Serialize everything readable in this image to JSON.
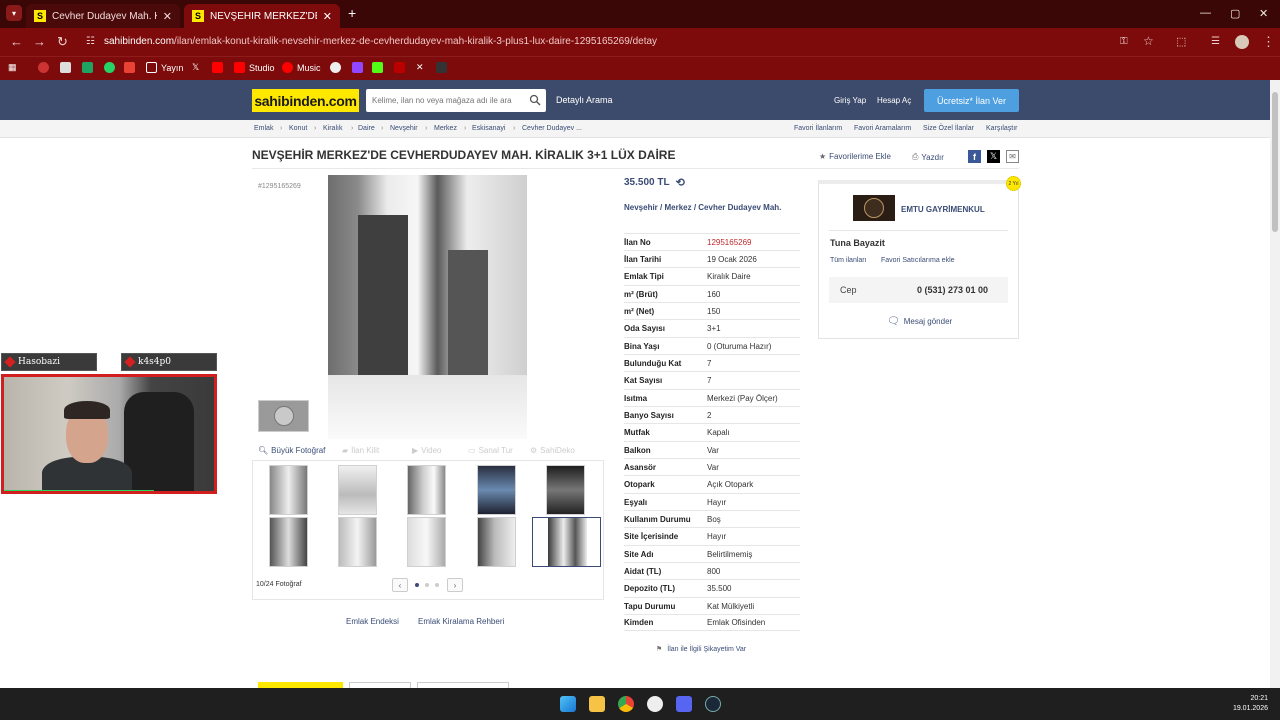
{
  "browser": {
    "tabs": [
      {
        "title": "Cevher Dudayev Mah. Kiralık Da",
        "active": false
      },
      {
        "title": "NEVŞEHİR MERKEZ'DE CEVHE",
        "active": true
      }
    ],
    "new_tab": "+",
    "url_host": "sahibinden.com",
    "url_path": "/ilan/emlak-konut-kiralik-nevsehir-merkez-de-cevherdudayev-mah-kiralik-3-plus1-lux-daire-1295165269/detay",
    "bookmarks": [
      "Yayın",
      "Studio",
      "Music"
    ]
  },
  "header": {
    "logo": "sahibinden.com",
    "search_placeholder": "Kelime, ilan no veya mağaza adı ile ara",
    "advanced_search": "Detaylı Arama",
    "login": "Giriş Yap",
    "register": "Hesap Aç",
    "post_ad": "Ücretsiz* İlan Ver"
  },
  "breadcrumbs": [
    "Emlak",
    "Konut",
    "Kiralık",
    "Daire",
    "Nevşehir",
    "Merkez",
    "Eskisanayi",
    "Cevher Dudayev ..."
  ],
  "right_links": [
    "Favori İlanlarım",
    "Favori Aramalarım",
    "Size Özel İlanlar",
    "Karşılaştır"
  ],
  "listing": {
    "title": "NEVŞEHİR MERKEZ'DE CEVHERDUDAYEV MAH. KİRALIK 3+1 LÜX DAİRE",
    "add_favorite": "Favorilerime Ekle",
    "print": "Yazdır",
    "id_tag": "#1295165269",
    "price": "35.500 TL",
    "location": [
      "Nevşehir",
      "Merkez",
      "Cevher Dudayev Mah."
    ],
    "details": [
      {
        "k": "İlan No",
        "v": "1295165269"
      },
      {
        "k": "İlan Tarihi",
        "v": "19 Ocak 2026"
      },
      {
        "k": "Emlak Tipi",
        "v": "Kiralık Daire"
      },
      {
        "k": "m² (Brüt)",
        "v": "160"
      },
      {
        "k": "m² (Net)",
        "v": "150"
      },
      {
        "k": "Oda Sayısı",
        "v": "3+1"
      },
      {
        "k": "Bina Yaşı",
        "v": "0 (Oturuma Hazır)"
      },
      {
        "k": "Bulunduğu Kat",
        "v": "7"
      },
      {
        "k": "Kat Sayısı",
        "v": "7"
      },
      {
        "k": "Isıtma",
        "v": "Merkezi (Pay Ölçer)"
      },
      {
        "k": "Banyo Sayısı",
        "v": "2"
      },
      {
        "k": "Mutfak",
        "v": "Kapalı"
      },
      {
        "k": "Balkon",
        "v": "Var"
      },
      {
        "k": "Asansör",
        "v": "Var"
      },
      {
        "k": "Otopark",
        "v": "Açık Otopark"
      },
      {
        "k": "Eşyalı",
        "v": "Hayır"
      },
      {
        "k": "Kullanım Durumu",
        "v": "Boş"
      },
      {
        "k": "Site İçerisinde",
        "v": "Hayır"
      },
      {
        "k": "Site Adı",
        "v": "Belirtilmemiş"
      },
      {
        "k": "Aidat (TL)",
        "v": "800"
      },
      {
        "k": "Depozito (TL)",
        "v": "35.500"
      },
      {
        "k": "Tapu Durumu",
        "v": "Kat Mülkiyetli"
      },
      {
        "k": "Kimden",
        "v": "Emlak Ofisinden"
      }
    ],
    "complaint": "İlan ile İlgili Şikayetim Var"
  },
  "gallery": {
    "tabs": [
      "Büyük Fotoğraf",
      "İlan Kilit",
      "Video",
      "Sanal Tur",
      "SahiDeko"
    ],
    "counter": "10/24 Fotoğraf",
    "prev": "‹",
    "next": "›",
    "links": [
      "Emlak Endeksi",
      "Emlak Kiralama Rehberi"
    ]
  },
  "seller": {
    "store": "EMTU GAYRİMENKUL",
    "agent": "Tuna Bayazit",
    "all_ads": "Tüm ilanları",
    "fav_seller": "Favori Satıcılarıma ekle",
    "phone_label": "Cep",
    "phone": "0 (531) 273 01 00",
    "message": "Mesaj gönder",
    "badge": "2 Yıl"
  },
  "stream": {
    "label_left": "Hasobazi",
    "label_right": "k4s4p0"
  },
  "taskbar": {
    "time": "20:21",
    "date": "19.01.2026"
  }
}
